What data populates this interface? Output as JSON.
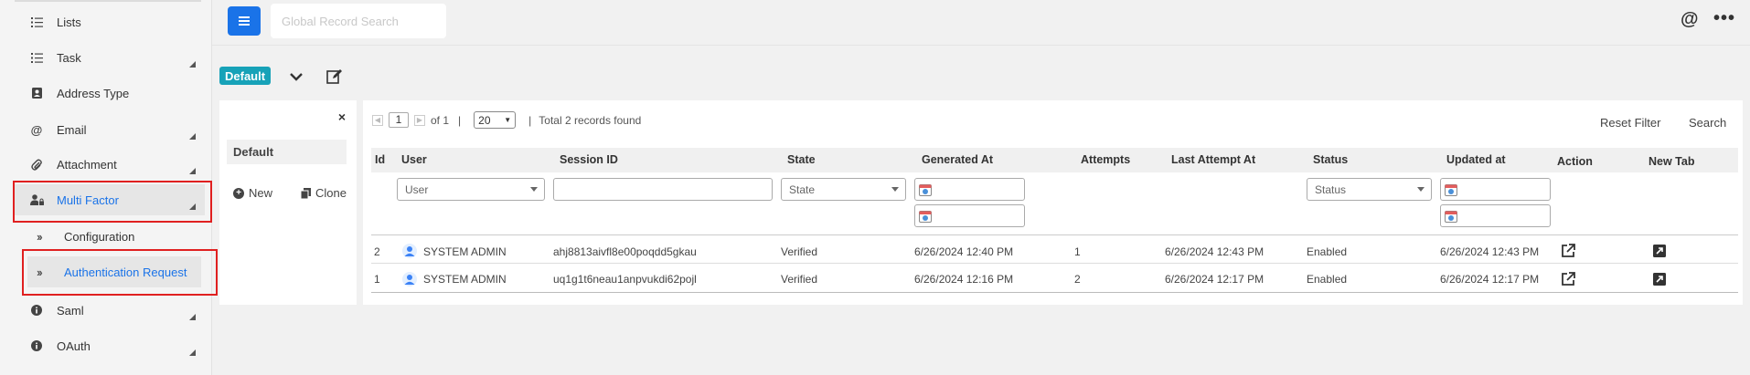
{
  "sidebar": {
    "items": [
      {
        "label": "Lists",
        "icon": "list-icon"
      },
      {
        "label": "Task",
        "icon": "list-icon"
      },
      {
        "label": "Address Type",
        "icon": "contact-card-icon"
      },
      {
        "label": "Email",
        "icon": "at-icon"
      },
      {
        "label": "Attachment",
        "icon": "paperclip-icon"
      },
      {
        "label": "Multi Factor",
        "icon": "user-lock-icon"
      },
      {
        "label": "Configuration",
        "icon": "double-chevron-right-icon"
      },
      {
        "label": "Authentication Request",
        "icon": "double-chevron-right-icon"
      },
      {
        "label": "Saml",
        "icon": "info-icon"
      },
      {
        "label": "OAuth",
        "icon": "info-icon"
      }
    ]
  },
  "topbar": {
    "search_placeholder": "Global Record Search",
    "at_symbol": "@",
    "more_symbol": "•••"
  },
  "view": {
    "current": "Default"
  },
  "left_panel": {
    "close": "×",
    "default_view": "Default",
    "new_label": "New",
    "clone_label": "Clone"
  },
  "pager": {
    "page": "1",
    "of_text": "of 1",
    "separator": "|",
    "page_size": "20",
    "total_text": "Total 2 records found"
  },
  "toolbar": {
    "reset_filter": "Reset Filter",
    "search": "Search"
  },
  "table": {
    "columns": [
      "Id",
      "User",
      "Session ID",
      "State",
      "Generated At",
      "Attempts",
      "Last Attempt At",
      "Status",
      "Updated at",
      "Action",
      "New Tab"
    ],
    "filters": {
      "user": "User",
      "state": "State",
      "status": "Status"
    },
    "rows": [
      {
        "id": "2",
        "user": "SYSTEM ADMIN",
        "session_id": "ahj8813aivfl8e00poqdd5gkau",
        "state": "Verified",
        "generated_at": "6/26/2024 12:40 PM",
        "attempts": "1",
        "last_attempt_at": "6/26/2024 12:43 PM",
        "status": "Enabled",
        "updated_at": "6/26/2024 12:43 PM"
      },
      {
        "id": "1",
        "user": "SYSTEM ADMIN",
        "session_id": "uq1g1t6neau1anpvukdi62pojl",
        "state": "Verified",
        "generated_at": "6/26/2024 12:16 PM",
        "attempts": "2",
        "last_attempt_at": "6/26/2024 12:17 PM",
        "status": "Enabled",
        "updated_at": "6/26/2024 12:17 PM"
      }
    ]
  },
  "colors": {
    "accent": "#1a73e8",
    "badge": "#17a2b8",
    "highlight_box": "#e02020"
  }
}
